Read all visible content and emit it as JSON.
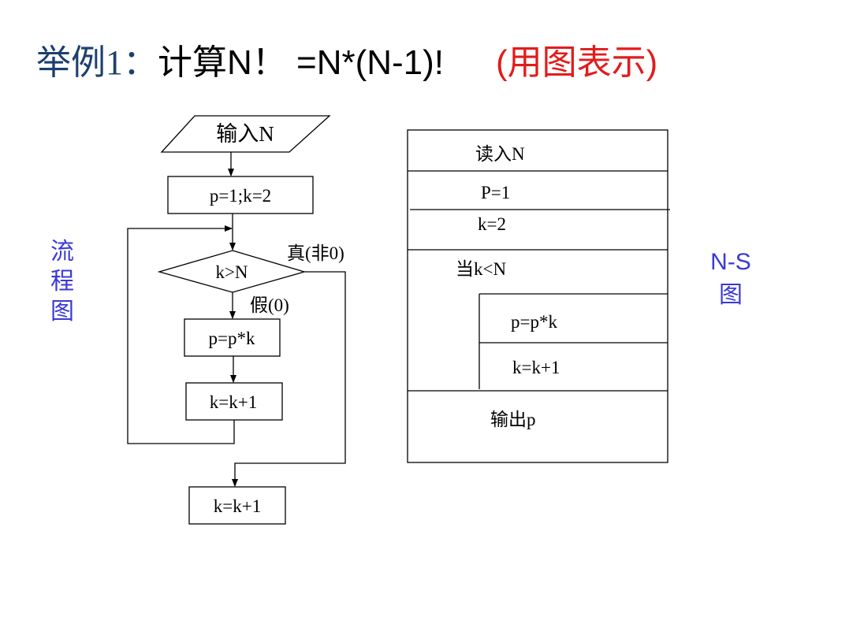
{
  "title": {
    "prefix": "举例1：",
    "formula": "计算N！ =N*(N-1)!",
    "note": "(用图表示)"
  },
  "flowchart": {
    "side_label": [
      "流",
      "程",
      "图"
    ],
    "input": "输入N",
    "init": "p=1;k=2",
    "condition": "k>N",
    "true_label": "真(非0)",
    "false_label": "假(0)",
    "step1": "p=p*k",
    "step2": "k=k+1",
    "exit_step": "k=k+1"
  },
  "ns_diagram": {
    "side_label": [
      "N-S",
      "图"
    ],
    "input": "读入N",
    "init_p": "P=1",
    "init_k": "k=2",
    "loop": "当k<N",
    "body1": "p=p*k",
    "body2": "k=k+1",
    "output": "输出p"
  },
  "colors": {
    "title": "#1d3f6e",
    "note": "#e31b1b",
    "side": "#3a3ad6"
  }
}
